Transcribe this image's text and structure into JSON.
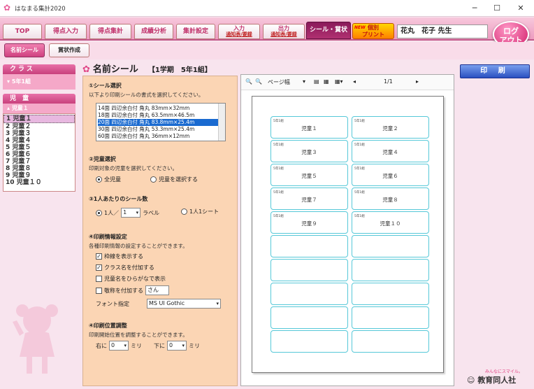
{
  "window": {
    "title": "はなまる集計2020",
    "minimize": "─",
    "maximize": "☐",
    "close": "✕"
  },
  "topmenu": [
    {
      "label": "TOP",
      "active": false
    },
    {
      "label": "得点入力",
      "active": false
    },
    {
      "label": "得点集計",
      "active": false
    },
    {
      "label": "成績分析",
      "active": false
    },
    {
      "label": "集計設定",
      "active": false
    },
    {
      "label": "入力",
      "sub": "通知表/要録",
      "active": false
    },
    {
      "label": "出力",
      "sub": "通知表/要録",
      "active": false
    },
    {
      "label": "シール・賞状",
      "active": true
    }
  ],
  "new_button": {
    "tag": "NEW",
    "line1": "個別",
    "line2": "プリント"
  },
  "teacher": "花丸　花子 先生",
  "logout": {
    "line1": "ログ",
    "line2": "アウト"
  },
  "submenu": [
    {
      "label": "名前シール",
      "active": true
    },
    {
      "label": "賞状作成",
      "active": false
    }
  ],
  "left": {
    "class_header": "クラス",
    "class_selected": "5年1組",
    "child_header": "児 童",
    "child_selected": "児童１",
    "children": [
      "1 児童１",
      "2 児童２",
      "3 児童３",
      "4 児童４",
      "5 児童５",
      "6 児童６",
      "7 児童７",
      "8 児童８",
      "9 児童９",
      "10 児童１０"
    ]
  },
  "main": {
    "title": "名前シール",
    "subtitle": "【1学期　5年1組】"
  },
  "settings": {
    "s1_title": "①シール選択",
    "s1_desc": "以下より印刷シールの書式を選択してください。",
    "seal_options": [
      "14面 四辺余白付 角丸 83mm×32mm",
      "18面 四辺余白付 角丸 63.5mm×46.5m",
      "20面 四辺余白付 角丸 83.8mm×25.4m",
      "30面 四辺余白付 角丸 53.3mm×25.4m",
      "60面 四辺余白付 角丸 36mm×12mm"
    ],
    "seal_selected": 2,
    "s2_title": "②児童選択",
    "s2_desc": "印刷対象の児童を選択してください。",
    "s2_opt1": "全児童",
    "s2_opt2": "児童を選択する",
    "s3_title": "③1人あたりのシール数",
    "s3_opt1a": "1人／",
    "s3_count": "1",
    "s3_opt1b": "ラベル",
    "s3_opt2": "1人1シート",
    "s4_title": "④印刷情報設定",
    "s4_desc": "各種印刷情報の設定することができます。",
    "chk_border": "枠線を表示する",
    "chk_class": "クラス名を付加する",
    "chk_kana": "児童名をひらがなで表示",
    "chk_suffix": "敬称を付加する",
    "suffix_value": "さん",
    "font_label": "フォント指定",
    "font_value": "MS UI Gothic",
    "s5_title": "④印刷位置調整",
    "s5_desc": "印刷開始位置を調整することができます。",
    "right_label": "右に",
    "right_value": "0",
    "down_label": "下に",
    "down_value": "0",
    "unit": "ミリ"
  },
  "preview": {
    "zoom_label": "ページ幅",
    "page": "1/1",
    "class_tag": "5年1組",
    "labels": [
      "児童１",
      "児童２",
      "児童３",
      "児童４",
      "児童５",
      "児童６",
      "児童７",
      "児童８",
      "児童９",
      "児童１０"
    ],
    "total_slots": 20
  },
  "print_button": "印 刷",
  "brand": {
    "slogan": "みんなにスマイル。",
    "name": "教育同人社"
  }
}
